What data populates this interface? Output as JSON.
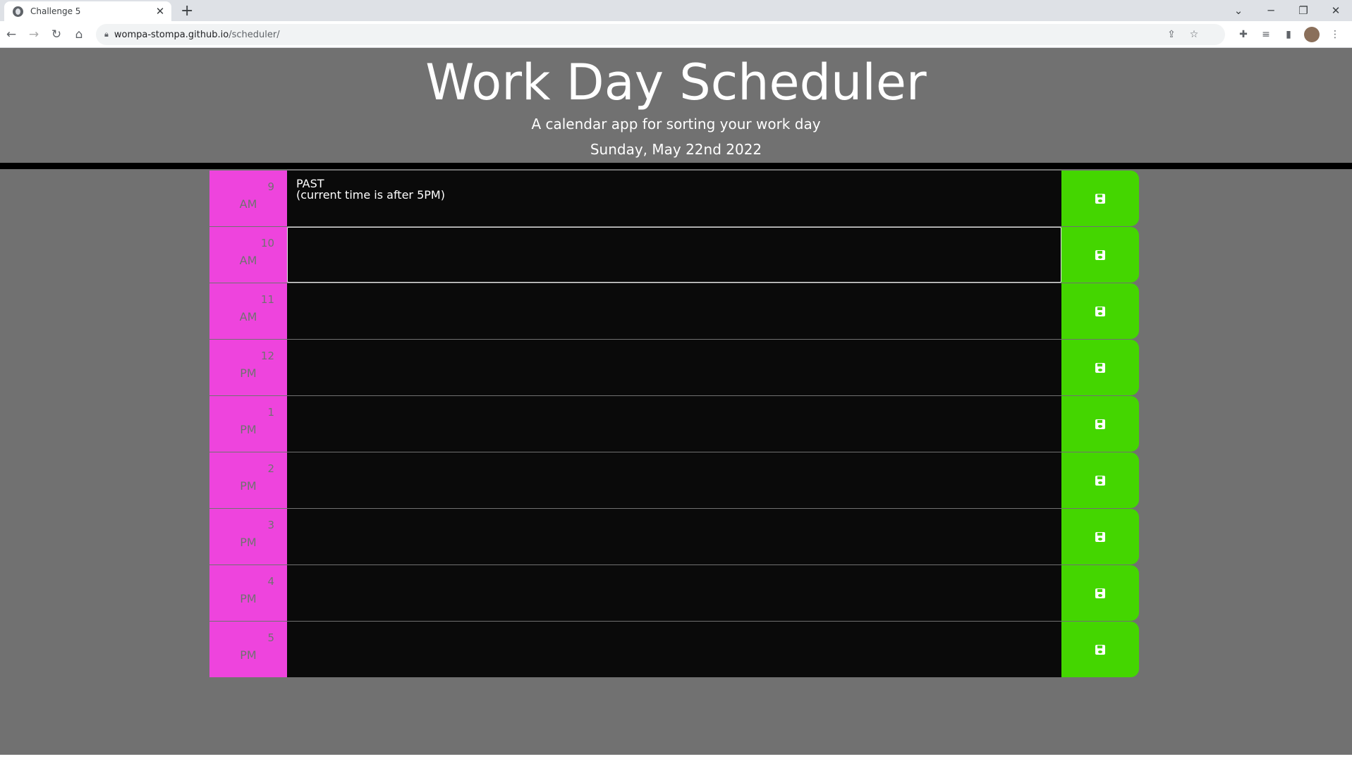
{
  "browser": {
    "tab_title": "Challenge 5",
    "tab_close": "✕",
    "new_tab": "+",
    "url_host": "wompa-stompa.github.io",
    "url_path": "/scheduler/"
  },
  "header": {
    "title": "Work Day Scheduler",
    "lead": "A calendar app for sorting your work day",
    "date": "Sunday, May 22nd 2022"
  },
  "hours": [
    {
      "num": "9",
      "ampm": "AM",
      "text": "PAST\n(current time is after 5PM)"
    },
    {
      "num": "10",
      "ampm": "AM",
      "text": ""
    },
    {
      "num": "11",
      "ampm": "AM",
      "text": ""
    },
    {
      "num": "12",
      "ampm": "PM",
      "text": ""
    },
    {
      "num": "1",
      "ampm": "PM",
      "text": ""
    },
    {
      "num": "2",
      "ampm": "PM",
      "text": ""
    },
    {
      "num": "3",
      "ampm": "PM",
      "text": ""
    },
    {
      "num": "4",
      "ampm": "PM",
      "text": ""
    },
    {
      "num": "5",
      "ampm": "PM",
      "text": ""
    }
  ],
  "colors": {
    "hour_block": "#ee44dd",
    "save_button": "#44d600",
    "description_bg": "#0a0a0a",
    "page_bg": "#717171"
  },
  "icons": {
    "save": "floppy-disk-icon"
  }
}
